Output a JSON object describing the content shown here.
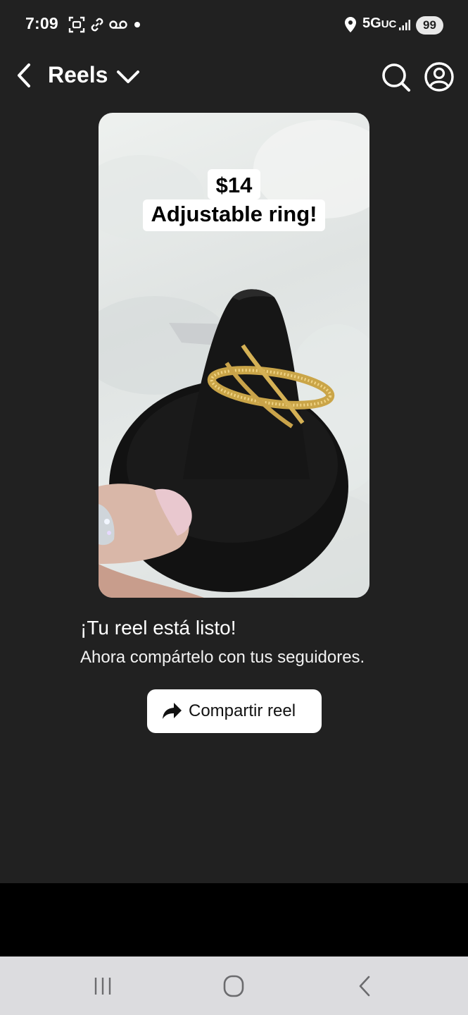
{
  "status_bar": {
    "time": "7:09",
    "network": "5G",
    "network_sub": "UC",
    "battery": "99",
    "icons": [
      "screenshot-icon",
      "link-icon",
      "voicemail-icon",
      "notification-dot",
      "location-icon",
      "signal-icon"
    ]
  },
  "header": {
    "title": "Reels",
    "icons": [
      "back-arrow-icon",
      "chevron-down-icon",
      "search-icon",
      "profile-icon"
    ]
  },
  "reel": {
    "caption_line1": "$14",
    "caption_line2": "Adjustable ring!"
  },
  "ready": {
    "title": "¡Tu reel está listo!",
    "subtitle": "Ahora compártelo con tus seguidores."
  },
  "share_button": {
    "label": "Compartir reel",
    "icon": "share-arrow-icon"
  },
  "nav_bar": {
    "icons": [
      "recent-apps-icon",
      "home-icon",
      "back-icon"
    ]
  },
  "colors": {
    "background": "#212121",
    "button_bg": "#ffffff",
    "nav_bg": "#dcdcdf"
  }
}
